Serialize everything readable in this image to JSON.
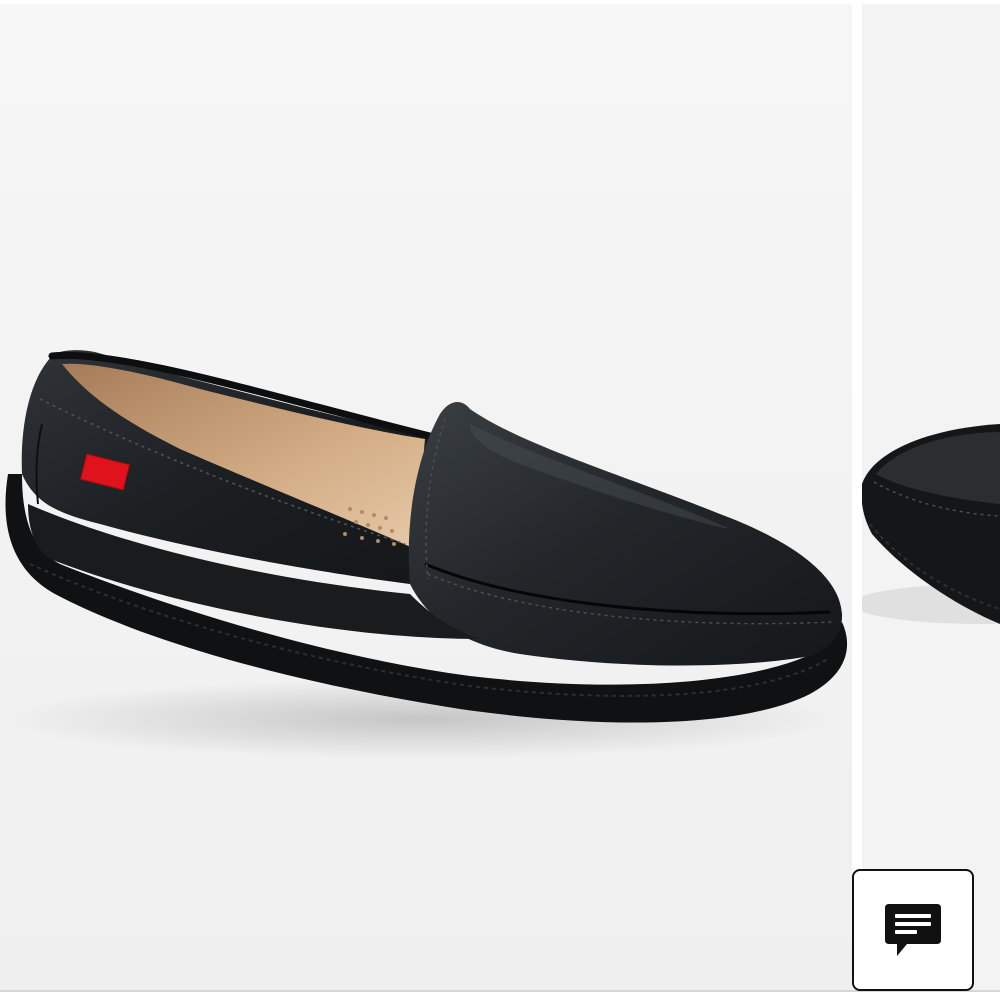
{
  "gallery": {
    "current_image": {
      "icon": "black-leather-loafer-photo",
      "colors": {
        "leather": "#1c1f22",
        "lining": "#c9a27c",
        "tag": "#e0121b",
        "background": "#f3f3f3"
      }
    },
    "next_image": {
      "icon": "black-loafer-partial-photo"
    }
  },
  "chat_widget": {
    "icon": "chat-bubble-icon",
    "border_color": "#111111",
    "icon_color": "#111111"
  }
}
